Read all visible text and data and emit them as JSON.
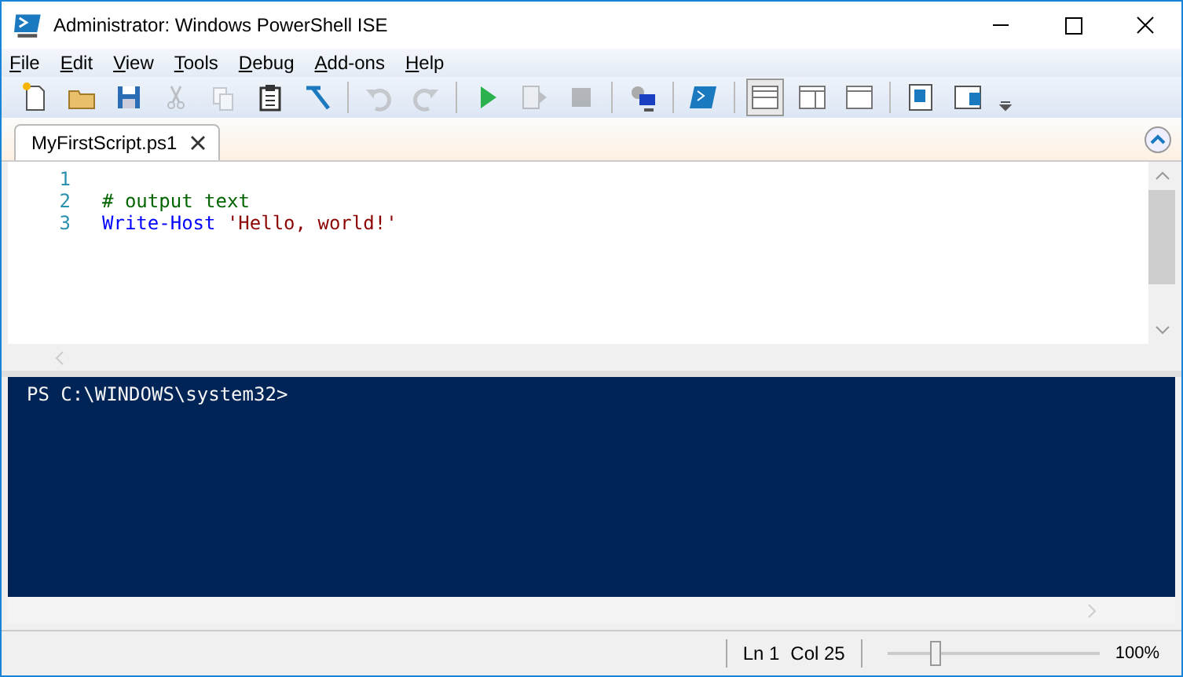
{
  "window": {
    "title": "Administrator: Windows PowerShell ISE"
  },
  "menu": [
    "File",
    "Edit",
    "View",
    "Tools",
    "Debug",
    "Add-ons",
    "Help"
  ],
  "toolbar": [
    {
      "kind": "new",
      "disabled": false
    },
    {
      "kind": "open",
      "disabled": false
    },
    {
      "kind": "save",
      "disabled": false
    },
    {
      "kind": "cut",
      "disabled": true
    },
    {
      "kind": "copy",
      "disabled": true
    },
    {
      "kind": "paste",
      "disabled": false
    },
    {
      "kind": "clear",
      "disabled": false
    },
    {
      "kind": "sep"
    },
    {
      "kind": "undo",
      "disabled": true
    },
    {
      "kind": "redo",
      "disabled": true
    },
    {
      "kind": "sep"
    },
    {
      "kind": "run",
      "disabled": false
    },
    {
      "kind": "runsel",
      "disabled": true
    },
    {
      "kind": "stop",
      "disabled": true
    },
    {
      "kind": "sep"
    },
    {
      "kind": "remote",
      "disabled": false
    },
    {
      "kind": "sep"
    },
    {
      "kind": "console",
      "disabled": false
    },
    {
      "kind": "sep"
    },
    {
      "kind": "layout-top",
      "selected": true
    },
    {
      "kind": "layout-right",
      "selected": false
    },
    {
      "kind": "layout-max",
      "selected": false
    },
    {
      "kind": "sep"
    },
    {
      "kind": "show-script",
      "disabled": false
    },
    {
      "kind": "show-console",
      "disabled": false
    }
  ],
  "tabs": [
    {
      "label": "MyFirstScript.ps1",
      "selected": true
    }
  ],
  "editor": {
    "lines": [
      {
        "number": "1"
      },
      {
        "number": "2",
        "tokens": [
          {
            "text": "# output text",
            "kind": "comment"
          }
        ]
      },
      {
        "number": "3",
        "tokens": [
          {
            "text": "Write-Host",
            "kind": "command"
          },
          {
            "text": "'Hello, world!'",
            "kind": "string"
          }
        ]
      }
    ]
  },
  "console": {
    "lines": [
      "PS C:\\WINDOWS\\system32>"
    ]
  },
  "status_bar": {
    "line": "Ln 1",
    "column": "Col 25",
    "zoom": {
      "level": 0.22,
      "reading": "100%"
    }
  }
}
